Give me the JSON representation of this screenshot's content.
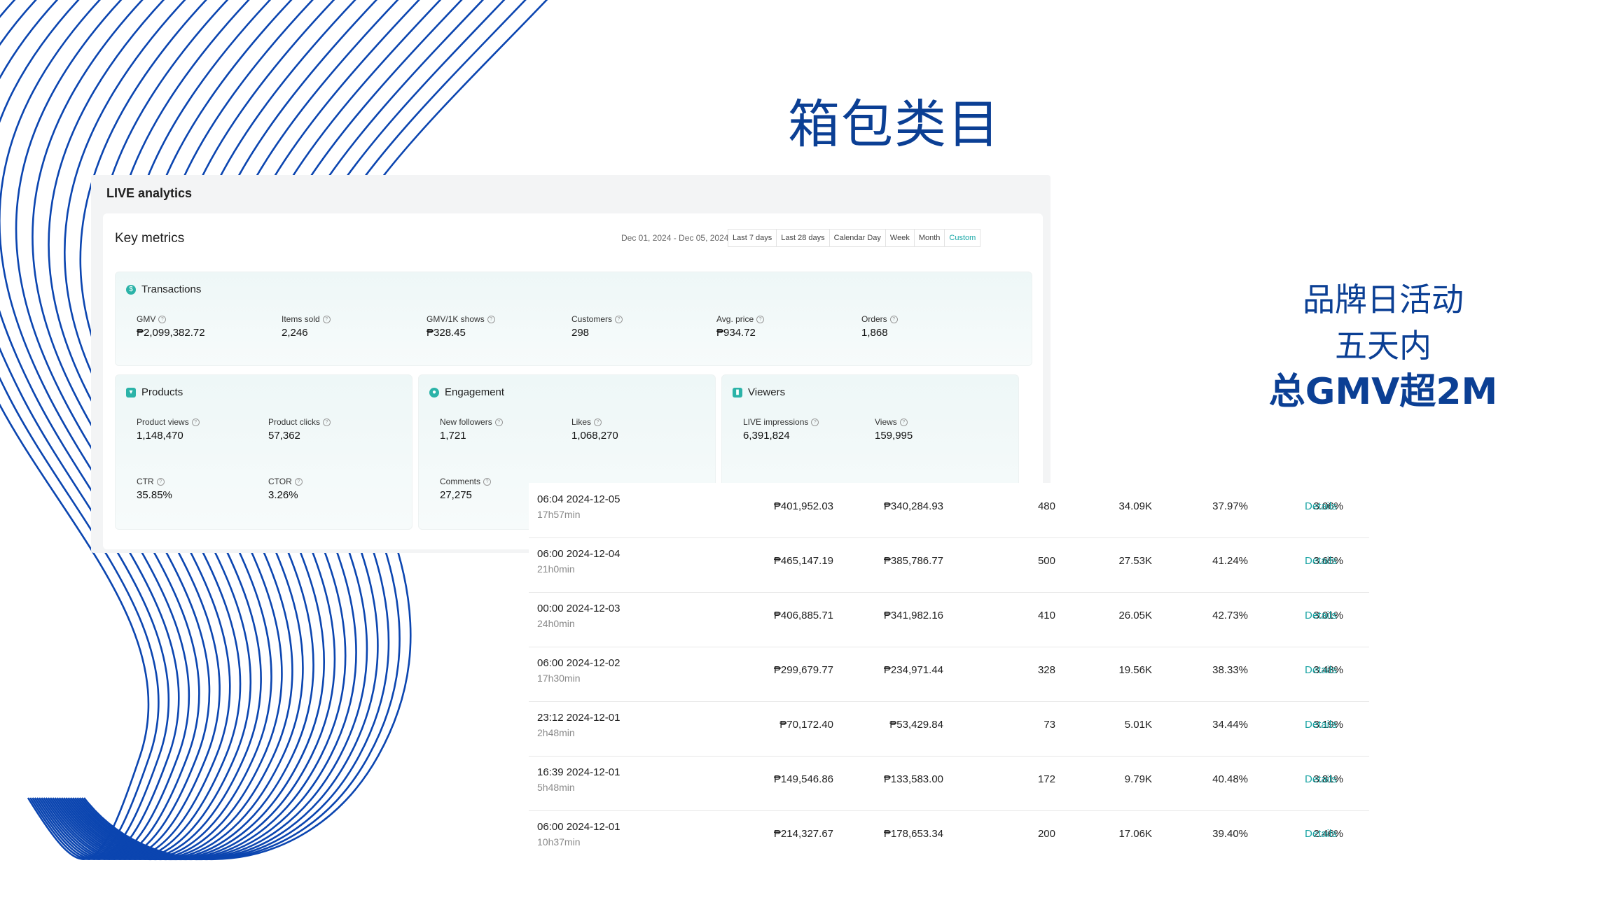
{
  "slide": {
    "title": "箱包类目",
    "side_lines": [
      "品牌日活动",
      "五天内",
      "总GMV超2M"
    ]
  },
  "analytics": {
    "heading": "LIVE analytics",
    "key_metrics_title": "Key metrics",
    "date_range": "Dec 01, 2024 - Dec 05, 2024",
    "range_buttons": [
      "Last 7 days",
      "Last 28 days",
      "Calendar Day",
      "Week",
      "Month",
      "Custom"
    ],
    "active_range": "Custom",
    "transactions": {
      "title": "Transactions",
      "metrics": [
        {
          "label": "GMV",
          "value": "₱2,099,382.72"
        },
        {
          "label": "Items sold",
          "value": "2,246"
        },
        {
          "label": "GMV/1K shows",
          "value": "₱328.45"
        },
        {
          "label": "Customers",
          "value": "298"
        },
        {
          "label": "Avg. price",
          "value": "₱934.72"
        },
        {
          "label": "Orders",
          "value": "1,868"
        }
      ]
    },
    "products": {
      "title": "Products",
      "metrics": [
        {
          "label": "Product views",
          "value": "1,148,470"
        },
        {
          "label": "Product clicks",
          "value": "57,362"
        },
        {
          "label": "CTR",
          "value": "35.85%"
        },
        {
          "label": "CTOR",
          "value": "3.26%"
        }
      ]
    },
    "engagement": {
      "title": "Engagement",
      "metrics": [
        {
          "label": "New followers",
          "value": "1,721"
        },
        {
          "label": "Likes",
          "value": "1,068,270"
        },
        {
          "label": "Comments",
          "value": "27,275"
        }
      ]
    },
    "viewers": {
      "title": "Viewers",
      "metrics": [
        {
          "label": "LIVE impressions",
          "value": "6,391,824"
        },
        {
          "label": "Views",
          "value": "159,995"
        }
      ]
    }
  },
  "sessions": {
    "details_label": "Details",
    "rows": [
      {
        "time": "06:04 2024-12-05",
        "duration": "17h57min",
        "c1": "₱401,952.03",
        "c2": "₱340,284.93",
        "c3": "480",
        "c4": "34.09K",
        "c5": "37.97%",
        "c6": "3.06%"
      },
      {
        "time": "06:00 2024-12-04",
        "duration": "21h0min",
        "c1": "₱465,147.19",
        "c2": "₱385,786.77",
        "c3": "500",
        "c4": "27.53K",
        "c5": "41.24%",
        "c6": "3.65%"
      },
      {
        "time": "00:00 2024-12-03",
        "duration": "24h0min",
        "c1": "₱406,885.71",
        "c2": "₱341,982.16",
        "c3": "410",
        "c4": "26.05K",
        "c5": "42.73%",
        "c6": "3.01%"
      },
      {
        "time": "06:00 2024-12-02",
        "duration": "17h30min",
        "c1": "₱299,679.77",
        "c2": "₱234,971.44",
        "c3": "328",
        "c4": "19.56K",
        "c5": "38.33%",
        "c6": "3.48%"
      },
      {
        "time": "23:12 2024-12-01",
        "duration": "2h48min",
        "c1": "₱70,172.40",
        "c2": "₱53,429.84",
        "c3": "73",
        "c4": "5.01K",
        "c5": "34.44%",
        "c6": "3.19%"
      },
      {
        "time": "16:39 2024-12-01",
        "duration": "5h48min",
        "c1": "₱149,546.86",
        "c2": "₱133,583.00",
        "c3": "172",
        "c4": "9.79K",
        "c5": "40.48%",
        "c6": "3.81%"
      },
      {
        "time": "06:00 2024-12-01",
        "duration": "10h37min",
        "c1": "₱214,327.67",
        "c2": "₱178,653.34",
        "c3": "200",
        "c4": "17.06K",
        "c5": "39.40%",
        "c6": "2.46%"
      }
    ]
  },
  "colors": {
    "brand_blue": "#0b3f94",
    "accent_teal": "#19a3a3"
  }
}
